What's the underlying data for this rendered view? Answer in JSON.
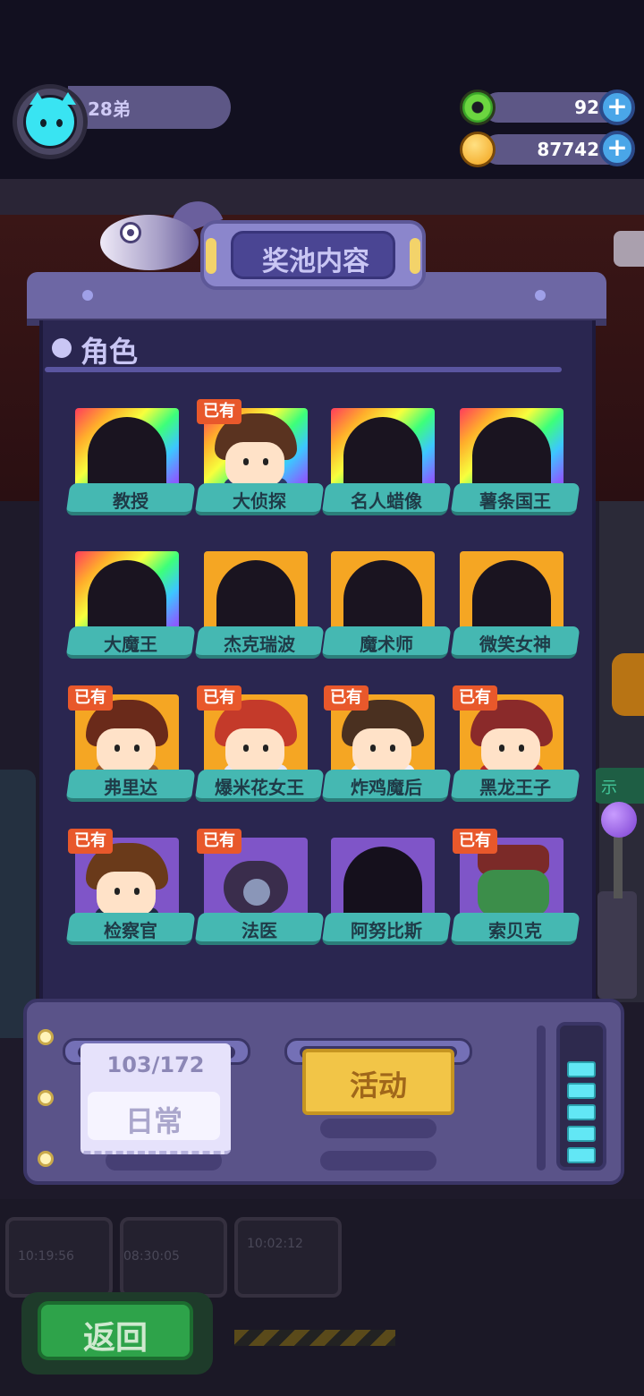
{
  "player": {
    "name": "28弟"
  },
  "resources": [
    {
      "icon": "donut-icon",
      "value": "92"
    },
    {
      "icon": "planet-coin-icon",
      "value": "87742"
    }
  ],
  "panel": {
    "title": "奖池内容",
    "section": "角色",
    "owned_label": "已有"
  },
  "characters": [
    {
      "name": "教授",
      "frame": "rainbow",
      "owned": false
    },
    {
      "name": "大侦探",
      "frame": "rainbow",
      "owned": true
    },
    {
      "name": "名人蜡像",
      "frame": "rainbow",
      "owned": false
    },
    {
      "name": "薯条国王",
      "frame": "rainbow",
      "owned": false
    },
    {
      "name": "大魔王",
      "frame": "rainbow",
      "owned": false
    },
    {
      "name": "杰克瑞波",
      "frame": "gold",
      "owned": false
    },
    {
      "name": "魔术师",
      "frame": "gold",
      "owned": false
    },
    {
      "name": "微笑女神",
      "frame": "gold",
      "owned": false
    },
    {
      "name": "弗里达",
      "frame": "gold",
      "owned": true
    },
    {
      "name": "爆米花女王",
      "frame": "gold",
      "owned": true
    },
    {
      "name": "炸鸡魔后",
      "frame": "gold",
      "owned": true
    },
    {
      "name": "黑龙王子",
      "frame": "gold",
      "owned": true
    },
    {
      "name": "检察官",
      "frame": "purple",
      "owned": true
    },
    {
      "name": "法医",
      "frame": "purple",
      "owned": true
    },
    {
      "name": "阿努比斯",
      "frame": "purple",
      "owned": false
    },
    {
      "name": "索贝克",
      "frame": "purple",
      "owned": true
    }
  ],
  "controls": {
    "daily_progress": "103/172",
    "daily_label": "日常",
    "event_label": "活动"
  },
  "background": {
    "timers": [
      "10:19:56",
      "08:30:05",
      "10:02:12"
    ],
    "side_tag": "示"
  },
  "back_label": "返回",
  "colors": {
    "panel": "#2a2650",
    "label_teal": "#45b8b2",
    "owned_tag": "#e8582b",
    "event_yellow": "#f2c547",
    "back_green": "#2ea34a"
  }
}
